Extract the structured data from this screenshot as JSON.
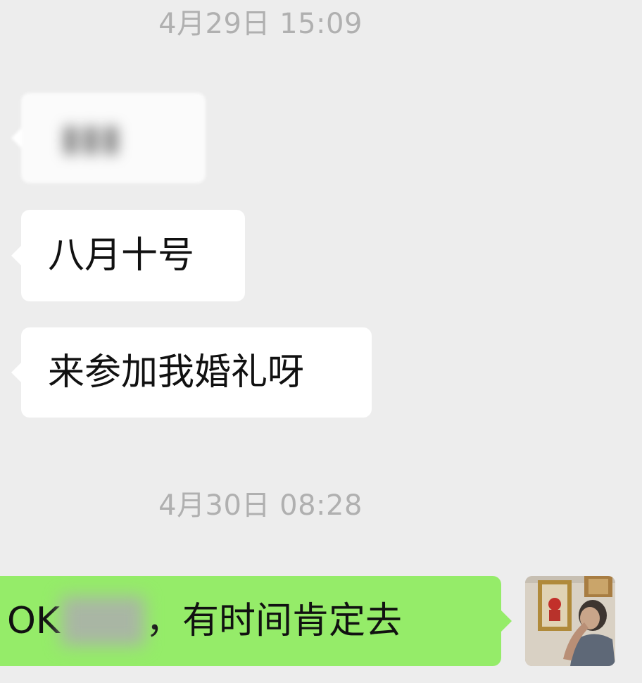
{
  "chat": {
    "timestamps": [
      "4月29日 15:09",
      "4月30日 08:28"
    ],
    "messages": [
      {
        "side": "left",
        "text": "▮▮▮",
        "redacted": true
      },
      {
        "side": "left",
        "text": "八月十号"
      },
      {
        "side": "left",
        "text": "来参加我婚礼呀"
      },
      {
        "side": "right",
        "text_before": "OK",
        "text_after": "，有时间肯定去",
        "partially_redacted": true
      }
    ]
  },
  "colors": {
    "background": "#ededed",
    "incoming_bubble": "#ffffff",
    "outgoing_bubble": "#95ec69",
    "timestamp_text": "#b0b0b0"
  },
  "icons": {
    "avatar": "user-photo-avatar"
  }
}
